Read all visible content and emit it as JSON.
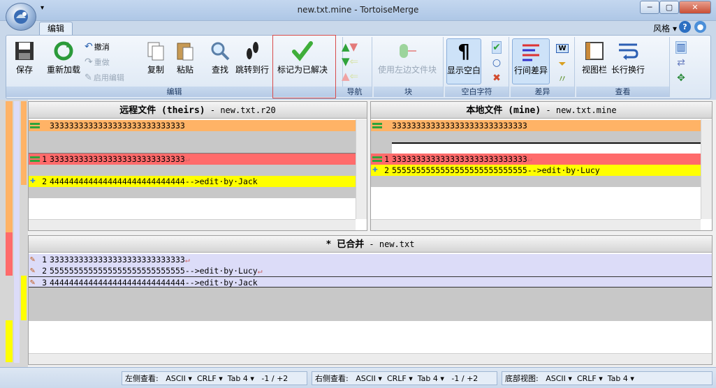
{
  "window": {
    "title": "new.txt.mine - TortoiseMerge",
    "qat_symbol": "▾",
    "min": "─",
    "max": "▢",
    "close": "✕"
  },
  "tabs": [
    {
      "label": "编辑"
    }
  ],
  "style_menu": {
    "label": "风格",
    "arrow": "▾"
  },
  "ribbon": {
    "groups": {
      "edit": "编辑",
      "nav": "导航",
      "block": "块",
      "whitespace": "空白字符",
      "diff": "差异",
      "view": "查看"
    },
    "buttons": {
      "save": "保存",
      "reload": "重新加载",
      "undo": "撤消",
      "redo": "重做",
      "enable_edit": "启用编辑",
      "copy": "复制",
      "paste": "粘贴",
      "find": "查找",
      "goto": "跳转到行",
      "mark_resolved": "标记为已解决",
      "use_left_block": "使用左边文件块",
      "show_whitespace": "显示空白",
      "inline_diff": "行间差异",
      "view_bar": "视图栏",
      "long_wrap": "长行换行",
      "w_icon": "W"
    }
  },
  "panes": {
    "left": {
      "title": "远程文件 (theirs)",
      "file": " - new.txt.r20",
      "lines": [
        {
          "num": "",
          "text": "3333333333333333333333333333"
        },
        {
          "num": "1",
          "text": "3333333333333333333333333333",
          "eol": "↵"
        },
        {
          "num": "2",
          "text": "4444444444444444444444444444-->edit·by·Jack"
        }
      ]
    },
    "right": {
      "title": "本地文件 (mine)",
      "file": " - new.txt.mine",
      "lines": [
        {
          "num": "",
          "text": "3333333333333333333333333333"
        },
        {
          "num": "1",
          "text": "3333333333333333333333333333",
          "eol": "↵"
        },
        {
          "num": "2",
          "text": "5555555555555555555555555555-->edit·by·Lucy"
        }
      ]
    },
    "merged": {
      "title": "* 已合并",
      "file": " - new.txt",
      "lines": [
        {
          "num": "1",
          "text": "3333333333333333333333333333",
          "eol": "↵"
        },
        {
          "num": "2",
          "text": "5555555555555555555555555555-->edit·by·Lucy",
          "eol": "↵"
        },
        {
          "num": "3",
          "text": "4444444444444444444444444444-->edit·by·Jack"
        }
      ]
    }
  },
  "statusbar": {
    "left_label": "左侧查看:",
    "right_label": "右侧查看:",
    "bottom_label": "底部视图:",
    "encoding": "ASCII",
    "eol": "CRLF",
    "tab": "Tab 4",
    "changes": "-1 / +2",
    "arrow": "▾"
  },
  "colors": {
    "conflict_red": "#ff6b6b",
    "changed_yellow": "#ffff00",
    "context_orange": "#ffb366",
    "merged_blue": "#dcdcf8",
    "empty_gray": "#c8c8c8"
  }
}
